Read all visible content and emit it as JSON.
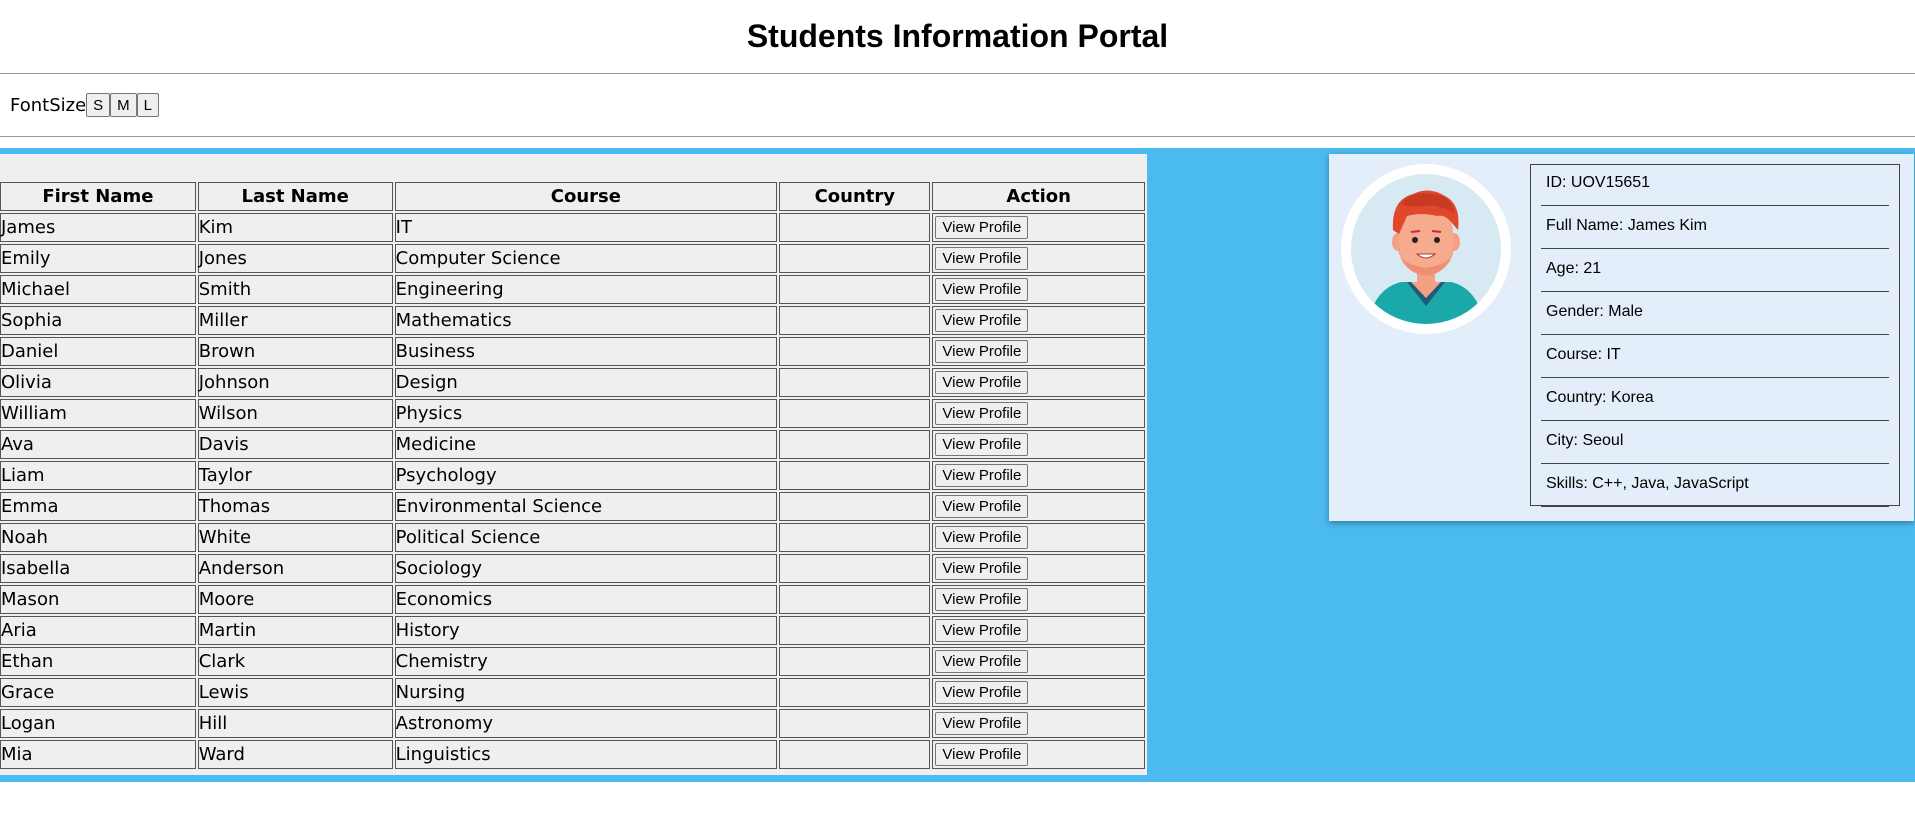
{
  "header": {
    "title": "Students Information Portal"
  },
  "fontsize": {
    "label": "FontSize",
    "options": [
      "S",
      "M",
      "L"
    ]
  },
  "table": {
    "columns": [
      "First Name",
      "Last Name",
      "Course",
      "Country",
      "Action"
    ],
    "action_label": "View Profile",
    "rows": [
      {
        "first": "James",
        "last": "Kim",
        "course": "IT",
        "country": ""
      },
      {
        "first": "Emily",
        "last": "Jones",
        "course": "Computer Science",
        "country": ""
      },
      {
        "first": "Michael",
        "last": "Smith",
        "course": "Engineering",
        "country": ""
      },
      {
        "first": "Sophia",
        "last": "Miller",
        "course": "Mathematics",
        "country": ""
      },
      {
        "first": "Daniel",
        "last": "Brown",
        "course": "Business",
        "country": ""
      },
      {
        "first": "Olivia",
        "last": "Johnson",
        "course": "Design",
        "country": ""
      },
      {
        "first": "William",
        "last": "Wilson",
        "course": "Physics",
        "country": ""
      },
      {
        "first": "Ava",
        "last": "Davis",
        "course": "Medicine",
        "country": ""
      },
      {
        "first": "Liam",
        "last": "Taylor",
        "course": "Psychology",
        "country": ""
      },
      {
        "first": "Emma",
        "last": "Thomas",
        "course": "Environmental Science",
        "country": ""
      },
      {
        "first": "Noah",
        "last": "White",
        "course": "Political Science",
        "country": ""
      },
      {
        "first": "Isabella",
        "last": "Anderson",
        "course": "Sociology",
        "country": ""
      },
      {
        "first": "Mason",
        "last": "Moore",
        "course": "Economics",
        "country": ""
      },
      {
        "first": "Aria",
        "last": "Martin",
        "course": "History",
        "country": ""
      },
      {
        "first": "Ethan",
        "last": "Clark",
        "course": "Chemistry",
        "country": ""
      },
      {
        "first": "Grace",
        "last": "Lewis",
        "course": "Nursing",
        "country": ""
      },
      {
        "first": "Logan",
        "last": "Hill",
        "course": "Astronomy",
        "country": ""
      },
      {
        "first": "Mia",
        "last": "Ward",
        "course": "Linguistics",
        "country": ""
      }
    ]
  },
  "profile": {
    "avatar_icon": "male-student-avatar-icon",
    "fields": [
      "ID: UOV15651",
      "Full Name: James Kim",
      "Age: 21",
      "Gender: Male",
      "Course: IT",
      "Country: Korea",
      "City: Seoul",
      "Skills: C++, Java, JavaScript"
    ]
  },
  "colors": {
    "panel_bg": "#4bbaf0",
    "profile_bg": "#e3eefa",
    "table_bg": "#efefef",
    "avatar_hair": "#e0472b",
    "avatar_shirt": "#1ba8a8"
  }
}
